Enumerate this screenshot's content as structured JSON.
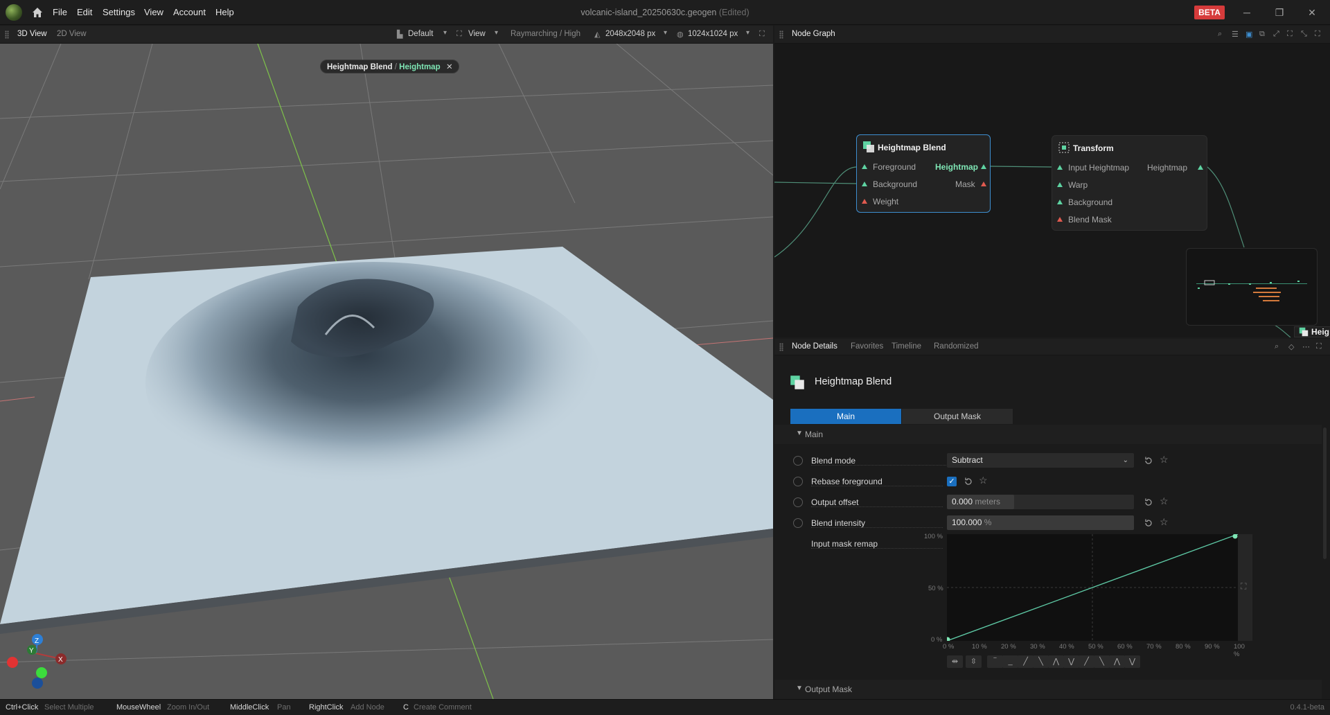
{
  "titlebar": {
    "menus": [
      "File",
      "Edit",
      "Settings",
      "View",
      "Account",
      "Help"
    ],
    "doc_title": "volcanic-island_20250630c.geogen",
    "doc_state": "(Edited)",
    "beta": "BETA"
  },
  "viewport_bar": {
    "tabs": [
      "3D View",
      "2D View"
    ],
    "camera": "Default",
    "view": "View",
    "render_mode": "Raymarching / High",
    "resolution": "2048x2048 px",
    "preview_resolution": "1024x1024 px"
  },
  "viewport": {
    "chip_node": "Heightmap Blend",
    "chip_sep": "/",
    "chip_output": "Heightmap",
    "chip_close": "✕",
    "gizmo": {
      "z": "Z",
      "y": "Y",
      "x": "X"
    }
  },
  "node_graph": {
    "title": "Node Graph",
    "nodes": {
      "blend": {
        "title": "Heightmap Blend",
        "inputs": [
          "Foreground",
          "Background",
          "Weight"
        ],
        "outputs": [
          "Heightmap",
          "Mask"
        ]
      },
      "transform": {
        "title": "Transform",
        "inputs": [
          "Input Heightmap",
          "Warp",
          "Background",
          "Blend Mask"
        ],
        "outputs": [
          "Heightmap"
        ]
      }
    },
    "offscreen_node_label": "Heig"
  },
  "node_details": {
    "tabs": [
      "Node Details",
      "Favorites",
      "Timeline",
      "Randomized"
    ],
    "title": "Heightmap Blend",
    "segments": [
      "Main",
      "Output Mask"
    ],
    "section_main": "Main",
    "section_output_mask": "Output Mask",
    "params": {
      "blend_mode": {
        "label": "Blend mode",
        "value": "Subtract"
      },
      "rebase_foreground": {
        "label": "Rebase foreground",
        "checked": true
      },
      "output_offset": {
        "label": "Output offset",
        "value": "0.000",
        "unit": "meters",
        "fill": 0.36
      },
      "blend_intensity": {
        "label": "Blend intensity",
        "value": "100.000",
        "unit": "%",
        "fill": 1.0
      },
      "input_mask_remap": {
        "label": "Input mask remap"
      }
    },
    "curve": {
      "y_ticks": [
        "100 %",
        "50 %",
        "0 %"
      ],
      "x_ticks": [
        "0 %",
        "10 %",
        "20 %",
        "30 %",
        "40 %",
        "50 %",
        "60 %",
        "70 %",
        "80 %",
        "90 %",
        "100 %"
      ]
    }
  },
  "status_bar": {
    "hints": [
      {
        "key": "Ctrl+Click",
        "desc": "Select Multiple"
      },
      {
        "key": "MouseWheel",
        "desc": "Zoom In/Out"
      },
      {
        "key": "MiddleClick",
        "desc": "Pan"
      },
      {
        "key": "RightClick",
        "desc": "Add Node"
      },
      {
        "key": "C",
        "desc": "Create Comment"
      }
    ],
    "version": "0.4.1-beta"
  },
  "colors": {
    "accent": "#1a6fbf",
    "selection": "#3e8fd1",
    "port_green": "#5ed3a2",
    "port_red": "#e05a4f",
    "beta": "#d63b3b"
  }
}
